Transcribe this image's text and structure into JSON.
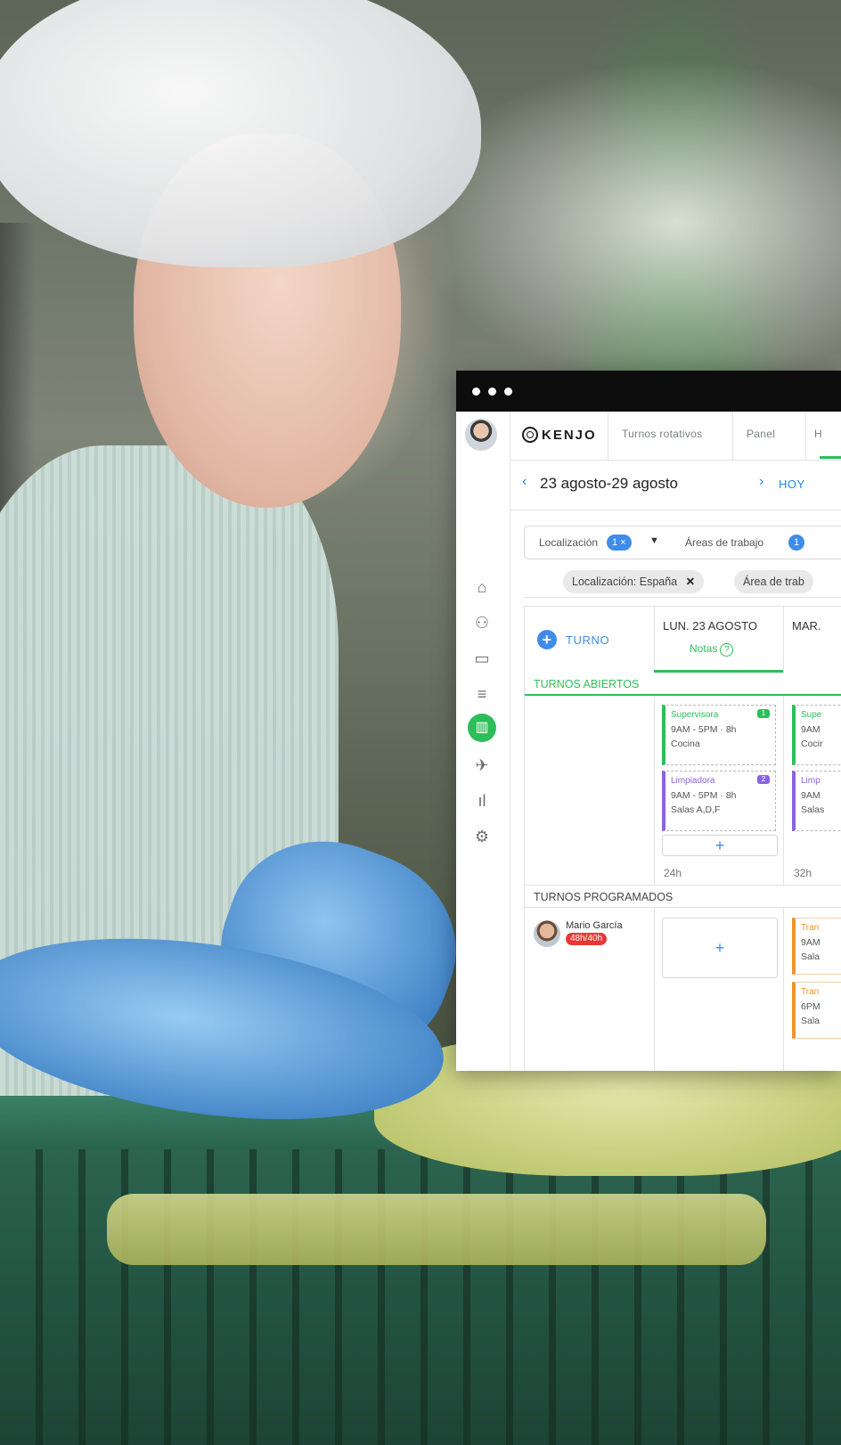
{
  "window": {
    "controls": [
      "close",
      "minimize",
      "maximize"
    ]
  },
  "sidebar": {
    "items": [
      {
        "name": "home",
        "icon": "home-icon",
        "glyph": "⌂"
      },
      {
        "name": "people",
        "icon": "people-icon",
        "glyph": "⚇"
      },
      {
        "name": "briefcase",
        "icon": "briefcase-icon",
        "glyph": "▭"
      },
      {
        "name": "list",
        "icon": "list-icon",
        "glyph": "≡"
      },
      {
        "name": "shifts",
        "icon": "shifts-icon",
        "glyph": "▥",
        "active": true
      },
      {
        "name": "travel",
        "icon": "plane-icon",
        "glyph": "✈"
      },
      {
        "name": "reports",
        "icon": "bar-chart-icon",
        "glyph": "ıl"
      },
      {
        "name": "settings",
        "icon": "gear-icon",
        "glyph": "⚙"
      }
    ]
  },
  "topnav": {
    "logo_text": "KENJO",
    "tabs": [
      "Turnos rotativos",
      "Panel",
      "H"
    ]
  },
  "datebar": {
    "prev": "‹",
    "range": "23 agosto-29 agosto",
    "next": "›",
    "today": "HOY"
  },
  "filters": {
    "location_label": "Localización",
    "location_count": "1 ×",
    "areas_label": "Áreas de trabajo",
    "areas_count": "1"
  },
  "chips": {
    "location_chip": "Localización: España",
    "location_chip_close": "✕",
    "area_chip": "Área de trab"
  },
  "grid": {
    "add_shift_label": "TURNO",
    "days": [
      {
        "label": "LUN. 23 AGOSTO",
        "notes": "Notas",
        "notes_help": "?",
        "selected": true
      },
      {
        "label": "MAR."
      }
    ],
    "open_shifts_title": "TURNOS ABIERTOS",
    "scheduled_shifts_title": "TURNOS PROGRAMADOS",
    "open_shifts": [
      {
        "role": "Supervisora",
        "time": "9AM - 5PM · 8h",
        "place": "Cocina",
        "count": "1",
        "color": "#2dbe5a"
      },
      {
        "role": "Limpiadora",
        "time": "9AM - 5PM · 8h",
        "place": "Salas A,D,F",
        "count": "2",
        "color": "#8b63e0"
      }
    ],
    "open_shifts_tue": [
      {
        "role": "Supe",
        "time": "9AM",
        "place": "Cocir"
      },
      {
        "role": "Limp",
        "time": "9AM",
        "place": "Salas"
      }
    ],
    "add_label": "+",
    "hours": [
      "24h",
      "32h"
    ],
    "employee": {
      "name": "Mario García",
      "hours": "48h/40h"
    },
    "scheduled_tue": [
      {
        "role": "Tran",
        "time": "9AM",
        "place": "Sala"
      },
      {
        "role": "Tran",
        "time": "6PM",
        "place": "Sala"
      }
    ]
  }
}
